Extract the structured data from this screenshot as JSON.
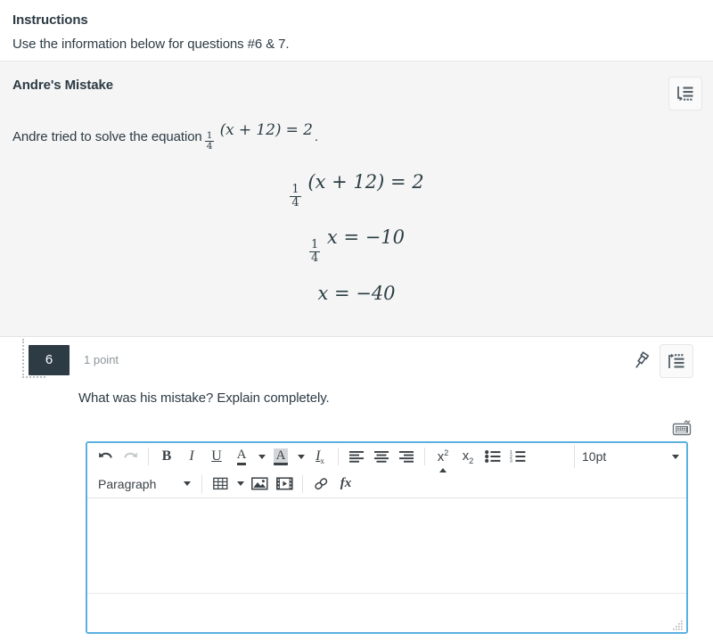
{
  "instructions": {
    "title": "Instructions",
    "body": "Use the information below for questions #6 & 7."
  },
  "stimulus": {
    "title": "Andre's Mistake",
    "intro_before": "Andre tried to solve the equation",
    "intro_after": ".",
    "intro_math": {
      "fraction_numerator": "1",
      "fraction_denominator": "4",
      "expression": "(x + 12) = 2"
    },
    "equations": [
      {
        "numerator": "1",
        "denominator": "4",
        "rest": "(x + 12) = 2"
      },
      {
        "numerator": "1",
        "denominator": "4",
        "rest": "x = −10"
      },
      {
        "numerator": "",
        "denominator": "",
        "rest": "x = −40"
      }
    ],
    "tool_icon": "outline-list-icon"
  },
  "question": {
    "number": "6",
    "points": "1 point",
    "text": "What was his mistake?  Explain completely.",
    "pin_icon": "pushpin-icon",
    "tool_icon": "outline-list-icon",
    "keyboard_icon": "equation-keyboard-icon"
  },
  "editor": {
    "toolbar_row1": [
      {
        "name": "undo-button",
        "icon": "undo-arrow-icon",
        "label": "",
        "disabled": false
      },
      {
        "name": "redo-button",
        "icon": "redo-arrow-icon",
        "label": "",
        "disabled": true
      },
      {
        "name": "bold-button",
        "icon": "bold-icon",
        "label": "B"
      },
      {
        "name": "italic-button",
        "icon": "italic-icon",
        "label": "I"
      },
      {
        "name": "underline-button",
        "icon": "underline-icon",
        "label": "U"
      },
      {
        "name": "text-color-button",
        "icon": "text-color-a-icon",
        "label": "A"
      },
      {
        "name": "highlight-color-button",
        "icon": "highlight-color-a-icon",
        "label": "A"
      },
      {
        "name": "clear-formatting-button",
        "icon": "clear-formatting-icon",
        "label": "I"
      },
      {
        "name": "align-left-button",
        "icon": "align-left-icon",
        "label": ""
      },
      {
        "name": "align-center-button",
        "icon": "align-center-icon",
        "label": ""
      },
      {
        "name": "align-right-button",
        "icon": "align-right-icon",
        "label": ""
      },
      {
        "name": "superscript-button",
        "icon": "superscript-icon",
        "label": "x"
      },
      {
        "name": "subscript-button",
        "icon": "subscript-icon",
        "label": "x"
      },
      {
        "name": "bullet-list-button",
        "icon": "bullet-list-icon",
        "label": ""
      },
      {
        "name": "numbered-list-button",
        "icon": "numbered-list-icon",
        "label": ""
      }
    ],
    "font_size": "10pt",
    "block_format": "Paragraph",
    "toolbar_row2": [
      {
        "name": "table-button",
        "icon": "table-icon"
      },
      {
        "name": "insert-image-button",
        "icon": "image-icon"
      },
      {
        "name": "insert-media-button",
        "icon": "media-icon"
      },
      {
        "name": "insert-link-button",
        "icon": "link-icon"
      },
      {
        "name": "insert-formula-button",
        "icon": "fx-formula-icon",
        "label": "fx"
      }
    ],
    "content": "",
    "resize_handle": "resize-grip-icon"
  },
  "colors": {
    "accent_border": "#5bb0e0",
    "badge_bg": "#2d3b45",
    "panel_bg": "#f5f5f5",
    "text": "#2d3b45",
    "muted_text": "#8b959b"
  }
}
